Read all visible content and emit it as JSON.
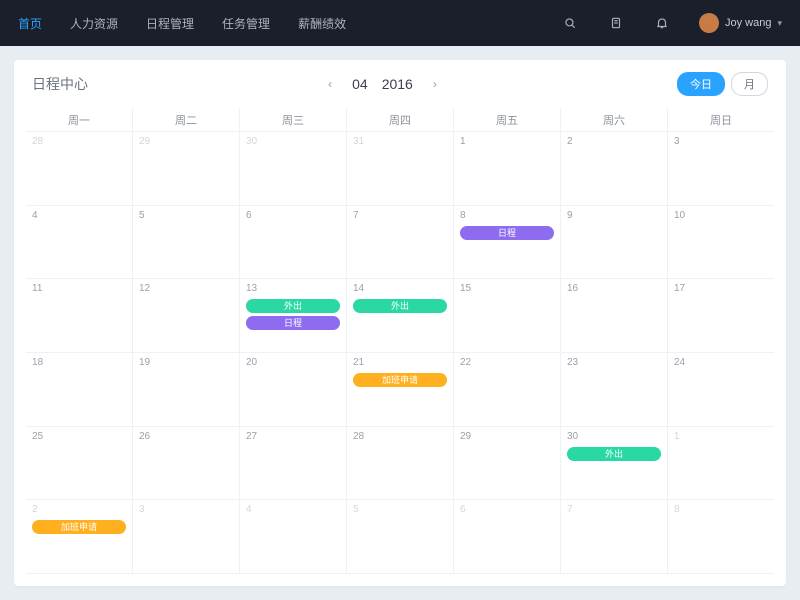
{
  "nav": {
    "items": [
      "首页",
      "人力资源",
      "日程管理",
      "任务管理",
      "薪酬绩效"
    ],
    "activeIndex": 0,
    "user": "Joy wang"
  },
  "panel": {
    "title": "日程中心",
    "month": "04",
    "year": "2016",
    "view_today": "今日",
    "view_month": "月"
  },
  "weekdays": [
    "周一",
    "周二",
    "周三",
    "周四",
    "周五",
    "周六",
    "周日"
  ],
  "days": [
    [
      {
        "n": "28",
        "muted": true
      },
      {
        "n": "29",
        "muted": true
      },
      {
        "n": "30",
        "muted": true
      },
      {
        "n": "31",
        "muted": true
      },
      {
        "n": "1"
      },
      {
        "n": "2"
      },
      {
        "n": "3"
      }
    ],
    [
      {
        "n": "4"
      },
      {
        "n": "5"
      },
      {
        "n": "6"
      },
      {
        "n": "7"
      },
      {
        "n": "8"
      },
      {
        "n": "9"
      },
      {
        "n": "10"
      }
    ],
    [
      {
        "n": "11"
      },
      {
        "n": "12"
      },
      {
        "n": "13"
      },
      {
        "n": "14"
      },
      {
        "n": "15"
      },
      {
        "n": "16"
      },
      {
        "n": "17"
      }
    ],
    [
      {
        "n": "18"
      },
      {
        "n": "19"
      },
      {
        "n": "20"
      },
      {
        "n": "21"
      },
      {
        "n": "22"
      },
      {
        "n": "23"
      },
      {
        "n": "24"
      }
    ],
    [
      {
        "n": "25"
      },
      {
        "n": "26"
      },
      {
        "n": "27"
      },
      {
        "n": "28"
      },
      {
        "n": "29"
      },
      {
        "n": "30"
      },
      {
        "n": "1",
        "muted": true
      }
    ],
    [
      {
        "n": "2",
        "muted": true
      },
      {
        "n": "3",
        "muted": true
      },
      {
        "n": "4",
        "muted": true
      },
      {
        "n": "5",
        "muted": true
      },
      {
        "n": "6",
        "muted": true
      },
      {
        "n": "7",
        "muted": true
      },
      {
        "n": "8",
        "muted": true
      }
    ]
  ],
  "events": [
    {
      "row": 1,
      "col": 4,
      "slot": 0,
      "color": "purple",
      "label": "日程"
    },
    {
      "row": 2,
      "col": 2,
      "slot": 0,
      "color": "green",
      "label": "外出"
    },
    {
      "row": 2,
      "col": 2,
      "slot": 1,
      "color": "purple",
      "label": "日程"
    },
    {
      "row": 2,
      "col": 3,
      "slot": 0,
      "color": "green",
      "label": "外出"
    },
    {
      "row": 3,
      "col": 3,
      "slot": 0,
      "color": "orange",
      "label": "加班申请"
    },
    {
      "row": 4,
      "col": 5,
      "slot": 0,
      "color": "green",
      "label": "外出"
    },
    {
      "row": 5,
      "col": 0,
      "slot": 0,
      "color": "orange",
      "label": "加班申请"
    }
  ]
}
